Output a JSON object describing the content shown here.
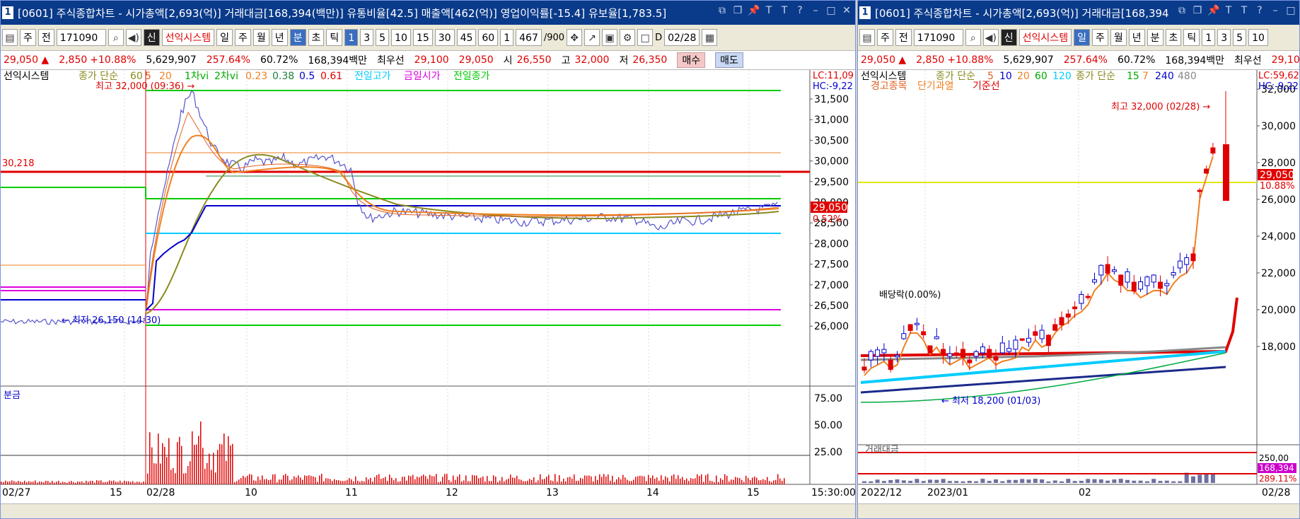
{
  "left": {
    "title": "[0601] 주식종합차트 - 시가총액[2,693(억)] 거래대금[168,394(백만)] 유통비율[42.5] 매출액[462(억)] 영업이익률[-15.4] 유보율[1,783.5]",
    "win_num": "1",
    "toolbar": {
      "type": "주",
      "all": "전",
      "code": "171090",
      "shin": "신",
      "system": "선익시스템",
      "il": "일",
      "ju": "주",
      "wol": "월",
      "nyeon": "년",
      "bun": "분",
      "cho": "초",
      "tik": "틱",
      "n1": "1",
      "n3": "3",
      "n5": "5",
      "n10": "10",
      "n15": "15",
      "n30": "30",
      "n45": "45",
      "n60": "60",
      "sel": "1",
      "count": "467",
      "total": "/900",
      "d_label": "D",
      "date": "02/28"
    },
    "quote": {
      "price": "29,050 ▲",
      "change": "2,850",
      "rate": "+10.88%",
      "volume": "5,629,907",
      "vol_rate": "257.64%",
      "turnover": "60.72%",
      "amount": "168,394백만",
      "best_label": "최우선",
      "best1": "29,100",
      "best2": "29,050",
      "open_label": "시",
      "open": "26,550",
      "high_label": "고",
      "high": "32,000",
      "low_label": "저",
      "low": "26,350",
      "buy": "매수",
      "sell": "매도"
    },
    "legend": {
      "name": "선익시스템",
      "ma": "종가 단순",
      "ma1": "60",
      "ma2": "5",
      "ma3": "20",
      "vi1": "1차vi",
      "vi2": "2차vi",
      "f1": "0.23",
      "f2": "0.38",
      "f3": "0.5",
      "f4": "0.61",
      "prev_high": "전일고가",
      "today_open": "금일시가",
      "prev_close": "전일종가"
    },
    "lc": "LC:11,09",
    "hc": "HC:-9,22",
    "high_note": "최고 32,000 (09:36) →",
    "low_note": "← 최저 26,150 (14:30)",
    "ref_value": "30,218",
    "price_tag": "29,050",
    "price_pct": "0.52%",
    "y_ticks": [
      "31,500",
      "31,000",
      "30,500",
      "30,000",
      "29,500",
      "29,000",
      "28,500",
      "28,000",
      "27,500",
      "27,000",
      "26,500",
      "26,000"
    ],
    "vol_title": "분금",
    "vol_ticks": [
      "75.00",
      "50.00",
      "25.00"
    ],
    "x_labels": [
      "02/27",
      "15",
      "02/28",
      "10",
      "11",
      "12",
      "13",
      "14",
      "15",
      "15:30:00"
    ]
  },
  "right": {
    "title": "[0601] 주식종합차트 - 시가총액[2,693(억)] 거래대금[168,394",
    "win_num": "1",
    "toolbar": {
      "type": "주",
      "all": "전",
      "code": "171090",
      "shin": "신",
      "system": "선익시스템",
      "il": "일",
      "ju": "주",
      "wol": "월",
      "nyeon": "년",
      "bun": "분",
      "cho": "초",
      "tik": "틱",
      "n1": "1",
      "n3": "3",
      "n5": "5",
      "n10": "10"
    },
    "quote": {
      "price": "29,050 ▲",
      "change": "2,850",
      "rate": "+10.88%",
      "volume": "5,629,907",
      "vol_rate": "257.64%",
      "turnover": "60.72%",
      "amount": "168,394백만",
      "best_label": "최우선",
      "best1": "29,10"
    },
    "legend": {
      "name": "선익시스템",
      "ma": "종가 단순",
      "m5": "5",
      "m10": "10",
      "m20": "20",
      "m60": "60",
      "m120": "120",
      "ma_b": "종가 단순",
      "m15": "15",
      "m7": "7",
      "m240": "240",
      "m480": "480",
      "warn": "경고종목",
      "short": "단기과열",
      "base": "기준선"
    },
    "lc": "LC:59,62",
    "hc": "HC:-9,22",
    "high_note": "최고 32,000 (02/28) →",
    "low_note": "← 최저 18,200 (01/03)",
    "div_note": "배당락(0.00%)",
    "price_tag": "29,050",
    "price_pct": "10.88%",
    "y_ticks": [
      "32,000",
      "30,000",
      "28,000",
      "26,000",
      "24,000",
      "22,000",
      "20,000",
      "18,000"
    ],
    "vol_title": "거래대금",
    "vol_ticks": [
      "250,00",
      "168,394",
      "289.11%"
    ],
    "x_labels": [
      "2022/12",
      "2023/01",
      "02",
      "02/28"
    ]
  },
  "colors": {
    "title_bg": "#0a3a8a",
    "red": "#e00000",
    "blue": "#0000cc",
    "green": "#00cc00",
    "cyan": "#00ccff",
    "magenta": "#e000e0",
    "olive": "#8a8a20",
    "orange": "#f08020",
    "yellow": "#e6e600"
  }
}
